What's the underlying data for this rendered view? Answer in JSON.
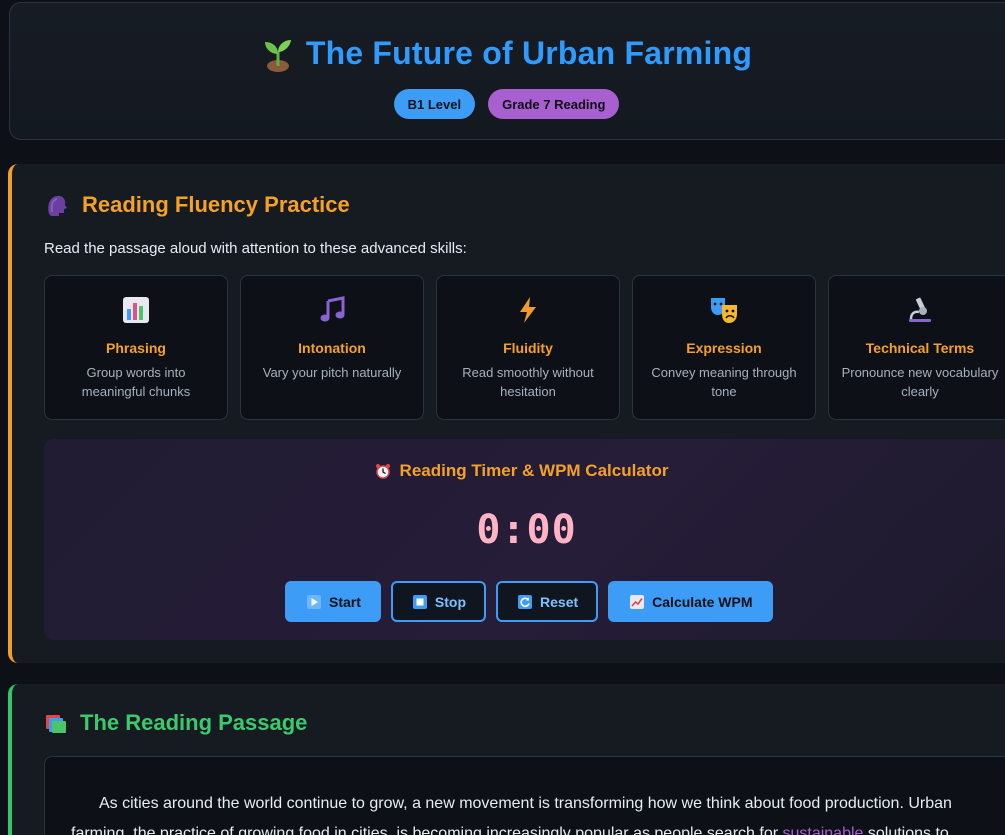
{
  "header": {
    "title": "The Future of Urban Farming",
    "title_icon": "sprout-icon",
    "badges": [
      "B1 Level",
      "Grade 7 Reading"
    ]
  },
  "fluency": {
    "heading": "Reading Fluency Practice",
    "heading_icon": "speaking-head-icon",
    "intro": "Read the passage aloud with attention to these advanced skills:",
    "skills": [
      {
        "icon": "bar-chart-icon",
        "title": "Phrasing",
        "desc": "Group words into meaningful chunks"
      },
      {
        "icon": "musical-notes-icon",
        "title": "Intonation",
        "desc": "Vary your pitch naturally"
      },
      {
        "icon": "lightning-icon",
        "title": "Fluidity",
        "desc": "Read smoothly without hesitation"
      },
      {
        "icon": "theater-masks-icon",
        "title": "Expression",
        "desc": "Convey meaning through tone"
      },
      {
        "icon": "microscope-icon",
        "title": "Technical Terms",
        "desc": "Pronounce new vocabulary clearly"
      }
    ]
  },
  "timer": {
    "heading": "Reading Timer & WPM Calculator",
    "heading_icon": "alarm-clock-icon",
    "display": "0:00",
    "buttons": {
      "start": "Start",
      "stop": "Stop",
      "reset": "Reset",
      "wpm": "Calculate WPM"
    }
  },
  "passage": {
    "heading": "The Reading Passage",
    "heading_icon": "books-icon",
    "text_before": "As cities around the world continue to grow, a new movement is transforming how we think about food production. Urban farming, the practice of growing food in cities, is becoming increasingly popular as people search for ",
    "vocab_word": "sustainable",
    "text_after": " solutions to"
  },
  "colors": {
    "accent_blue": "#3d9df6",
    "accent_orange": "#f5a126",
    "accent_green": "#3cc96c",
    "accent_purple": "#a85fcf",
    "background": "#0d1117"
  }
}
